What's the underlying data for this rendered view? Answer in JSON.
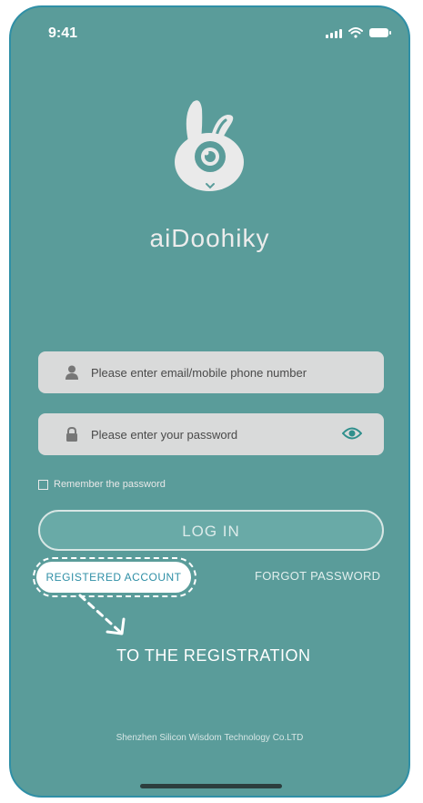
{
  "status_bar": {
    "time": "9:41"
  },
  "app": {
    "name": "aiDoohiky"
  },
  "login_form": {
    "account_placeholder": "Please enter email/mobile phone number",
    "password_placeholder": "Please enter your password",
    "remember_label": "Remember the password",
    "login_label": "LOG IN",
    "register_label": "REGISTERED ACCOUNT",
    "forgot_label": "FORGOT PASSWORD"
  },
  "annotation": {
    "hint": "TO THE REGISTRATION"
  },
  "footer": {
    "company": "Shenzhen Silicon Wisdom Technology Co.LTD"
  },
  "colors": {
    "background": "#5a9c9a",
    "field": "#d9dada",
    "accent": "#2f8fa6"
  },
  "icons": [
    "person-icon",
    "lock-icon",
    "eye-icon",
    "signal-icon",
    "wifi-icon",
    "battery-icon"
  ]
}
